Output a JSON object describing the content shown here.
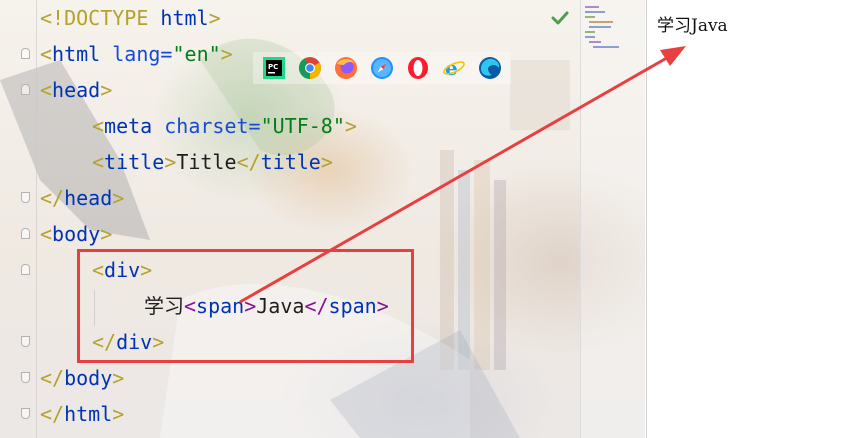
{
  "editor": {
    "lines": [
      {
        "tokens": [
          {
            "t": "<!DOCTYPE ",
            "c": "tag-o"
          },
          {
            "t": "html",
            "c": "kw"
          },
          {
            "t": ">",
            "c": "tag-o"
          }
        ]
      },
      {
        "tokens": [
          {
            "t": "<",
            "c": "tag-o"
          },
          {
            "t": "html ",
            "c": "kw"
          },
          {
            "t": "lang=",
            "c": "attr"
          },
          {
            "t": "\"en\"",
            "c": "str"
          },
          {
            "t": ">",
            "c": "tag-o"
          }
        ]
      },
      {
        "tokens": [
          {
            "t": "<",
            "c": "tag-o"
          },
          {
            "t": "head",
            "c": "kw"
          },
          {
            "t": ">",
            "c": "tag-o"
          }
        ]
      },
      {
        "indent": 1,
        "tokens": [
          {
            "t": "<",
            "c": "tag-o"
          },
          {
            "t": "meta ",
            "c": "kw"
          },
          {
            "t": "charset=",
            "c": "attr"
          },
          {
            "t": "\"UTF-8\"",
            "c": "str"
          },
          {
            "t": ">",
            "c": "tag-o"
          }
        ]
      },
      {
        "indent": 1,
        "tokens": [
          {
            "t": "<",
            "c": "tag-o"
          },
          {
            "t": "title",
            "c": "kw"
          },
          {
            "t": ">",
            "c": "tag-o"
          },
          {
            "t": "Title",
            "c": "txt"
          },
          {
            "t": "</",
            "c": "tag-o"
          },
          {
            "t": "title",
            "c": "kw"
          },
          {
            "t": ">",
            "c": "tag-o"
          }
        ]
      },
      {
        "tokens": [
          {
            "t": "</",
            "c": "tag-o"
          },
          {
            "t": "head",
            "c": "kw"
          },
          {
            "t": ">",
            "c": "tag-o"
          }
        ]
      },
      {
        "tokens": [
          {
            "t": "<",
            "c": "tag-o"
          },
          {
            "t": "body",
            "c": "kw"
          },
          {
            "t": ">",
            "c": "tag-o"
          }
        ]
      },
      {
        "indent": 1,
        "tokens": [
          {
            "t": "<",
            "c": "tag-o"
          },
          {
            "t": "div",
            "c": "kw"
          },
          {
            "t": ">",
            "c": "tag-o"
          }
        ]
      },
      {
        "indent": 2,
        "tokens": [
          {
            "t": "学习",
            "c": "txt cjk"
          },
          {
            "t": "<",
            "c": "span-t"
          },
          {
            "t": "span",
            "c": "kw"
          },
          {
            "t": ">",
            "c": "span-t"
          },
          {
            "t": "Java",
            "c": "txt"
          },
          {
            "t": "</",
            "c": "span-t"
          },
          {
            "t": "span",
            "c": "kw"
          },
          {
            "t": ">",
            "c": "span-t"
          }
        ]
      },
      {
        "indent": 1,
        "tokens": [
          {
            "t": "</",
            "c": "tag-o"
          },
          {
            "t": "div",
            "c": "kw"
          },
          {
            "t": ">",
            "c": "tag-o"
          }
        ]
      },
      {
        "tokens": [
          {
            "t": "</",
            "c": "tag-o"
          },
          {
            "t": "body",
            "c": "kw"
          },
          {
            "t": ">",
            "c": "tag-o"
          }
        ]
      },
      {
        "tokens": [
          {
            "t": "</",
            "c": "tag-o"
          },
          {
            "t": "html",
            "c": "kw"
          },
          {
            "t": ">",
            "c": "tag-o"
          }
        ]
      }
    ]
  },
  "browser_icons": [
    {
      "name": "pycharm-icon",
      "label": "PC"
    },
    {
      "name": "chrome-icon"
    },
    {
      "name": "firefox-icon"
    },
    {
      "name": "safari-icon"
    },
    {
      "name": "opera-icon"
    },
    {
      "name": "internet-explorer-icon"
    },
    {
      "name": "edge-icon"
    }
  ],
  "inspection": {
    "status_icon": "check-icon",
    "color": "#4f9d4f"
  },
  "highlight": {
    "color": "#e84040"
  },
  "preview": {
    "text": "学习Java"
  }
}
